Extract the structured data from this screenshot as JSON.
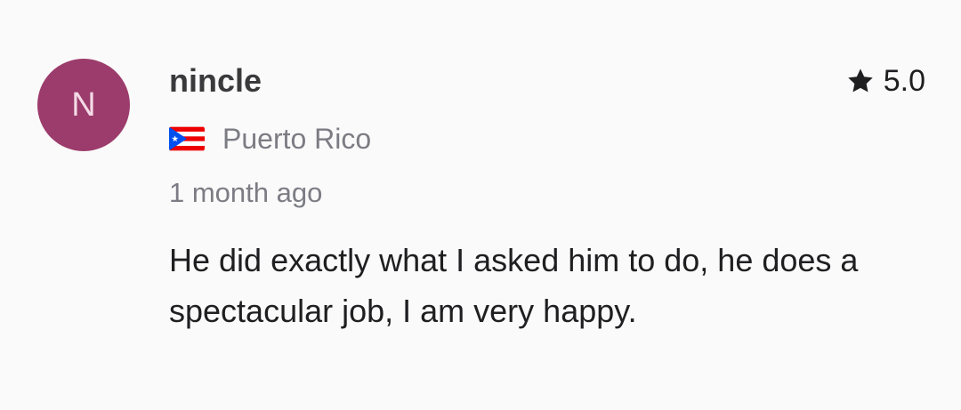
{
  "review": {
    "avatar_initial": "N",
    "reviewer_name": "nincle",
    "rating": "5.0",
    "country": "Puerto Rico",
    "country_flag_icon": "puerto-rico-flag-icon",
    "time_ago": "1 month ago",
    "text": "He did exactly what I asked him to do, he does a spectacular job, I am very happy."
  },
  "colors": {
    "background": "#fafafa",
    "avatar_bg": "#9c3c6c",
    "avatar_text": "#f4dbe6",
    "name": "#3a3a3c",
    "muted": "#7c7c84",
    "body": "#1f1f21"
  }
}
